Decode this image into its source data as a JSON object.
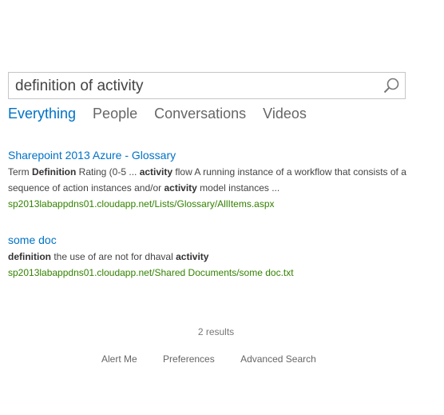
{
  "search": {
    "query": "definition of activity"
  },
  "verticals": [
    {
      "label": "Everything",
      "active": true
    },
    {
      "label": "People",
      "active": false
    },
    {
      "label": "Conversations",
      "active": false
    },
    {
      "label": "Videos",
      "active": false
    }
  ],
  "results": [
    {
      "title": "Sharepoint 2013 Azure - Glossary",
      "summary_parts": [
        {
          "t": "Term  ",
          "b": false
        },
        {
          "t": "Definition",
          "b": true
        },
        {
          "t": " Rating (0-5 ... ",
          "b": false
        },
        {
          "t": "activity",
          "b": true
        },
        {
          "t": " flow  A running instance of a workflow that consists of a sequence of action instances and/or ",
          "b": false
        },
        {
          "t": "activity",
          "b": true
        },
        {
          "t": " model instances ...",
          "b": false
        }
      ],
      "url": "sp2013labappdns01.cloudapp.net/Lists/Glossary/AllItems.aspx"
    },
    {
      "title": "some doc",
      "summary_parts": [
        {
          "t": "definition",
          "b": true
        },
        {
          "t": " the use of are not for dhaval ",
          "b": false
        },
        {
          "t": "activity",
          "b": true
        }
      ],
      "url": "sp2013labappdns01.cloudapp.net/Shared Documents/some doc.txt"
    }
  ],
  "result_count": "2 results",
  "footer": {
    "alert_me": "Alert Me",
    "preferences": "Preferences",
    "advanced_search": "Advanced Search"
  },
  "icons": {
    "search": "search-icon"
  },
  "colors": {
    "link": "#0072c6",
    "url": "#338200",
    "text": "#444444",
    "muted": "#666666"
  }
}
